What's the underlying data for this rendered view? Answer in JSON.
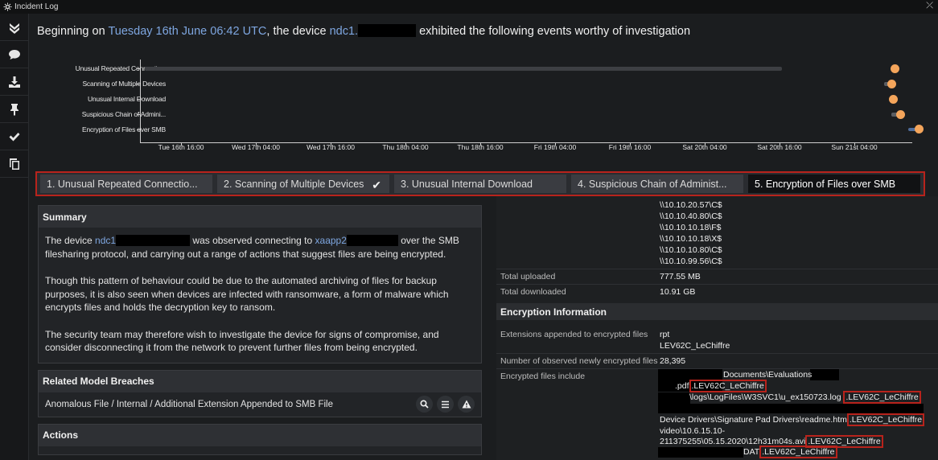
{
  "window": {
    "title": "Incident Log",
    "close": "⤫"
  },
  "sidebar": {
    "items": [
      "collapse",
      "comment",
      "download",
      "pin",
      "confirm",
      "copy"
    ]
  },
  "headline": {
    "prefix": "Beginning on ",
    "date": "Tuesday 16th June 06:42 UTC",
    "mid": ", the device ",
    "device": "ndc1.",
    "suffix": "exhibited the following events worthy of investigation"
  },
  "timeline": {
    "rows": [
      "Unusual Repeated Connectio...",
      "Scanning of Multiple Devices",
      "Unusual Internal Download",
      "Suspicious Chain of Admini...",
      "Encryption of Files over SMB"
    ],
    "dates": [
      "Tue 16th 16:00",
      "Wed 17th 04:00",
      "Wed 17th 16:00",
      "Thu 18th 04:00",
      "Thu 18th 16:00",
      "Fri 19th 04:00",
      "Fri 19th 16:00",
      "Sat 20th 04:00",
      "Sat 20th 16:00",
      "Sun 21st 04:00"
    ]
  },
  "tabs": [
    {
      "label": "1. Unusual Repeated Connectio...",
      "checked": false,
      "active": false
    },
    {
      "label": "2. Scanning of Multiple Devices",
      "checked": true,
      "active": false
    },
    {
      "label": "3. Unusual Internal Download",
      "checked": false,
      "active": false
    },
    {
      "label": "4. Suspicious Chain of Administ...",
      "checked": false,
      "active": false
    },
    {
      "label": "5. Encryption of Files over SMB",
      "checked": false,
      "active": true
    }
  ],
  "check_glyph": "✔",
  "summary": {
    "title": "Summary",
    "p1_a": "The device ",
    "p1_device": "ndc1",
    "p1_b": " was observed connecting to ",
    "p1_target": "xaapp2",
    "p1_c": " over the SMB filesharing protocol, and carrying out a range of actions that suggest files are being encrypted.",
    "p2": "Though this pattern of behaviour could be due to the automated archiving of files for backup purposes, it is also seen when devices are infected with ransomware, a form of malware which encrypts files and holds the decryption key to ransom.",
    "p3": "The security team may therefore wish to investigate the device for signs of compromise, and consider disconnecting it from the network to prevent further files from being encrypted."
  },
  "breaches": {
    "title": "Related Model Breaches",
    "item": "Anomalous File / Internal / Additional Extension Appended to SMB File",
    "icons": [
      "search-icon",
      "menu-icon",
      "warning-icon"
    ]
  },
  "actions": {
    "title": "Actions"
  },
  "details": {
    "shares": [
      "\\\\10.10.20.57\\C$",
      "\\\\10.10.40.80\\C$",
      "\\\\10.10.10.18\\F$",
      "\\\\10.10.10.18\\X$",
      "\\\\10.10.10.80\\C$",
      "\\\\10.10.99.56\\C$"
    ],
    "total_uploaded_label": "Total uploaded",
    "total_uploaded": "777.55 MB",
    "total_downloaded_label": "Total downloaded",
    "total_downloaded": "10.91 GB",
    "enc_title": "Encryption Information",
    "ext_label": "Extensions appended to encrypted files",
    "ext_1": "rpt",
    "ext_2": "LEV62C_LeChiffre",
    "count_label": "Number of observed newly encrypted files",
    "count": "28,395",
    "files_label": "Encrypted files include",
    "f1": "Documents\\Evaluations",
    "f2": ".pdf",
    "f2_ext": ".LEV62C_LeChiffre",
    "f3": "\\logs\\LogFiles\\W3SVC1\\u_ex150723.log",
    "f3_ext": ".LEV62C_LeChiffre",
    "f4": "Device Drivers\\Signature Pad Drivers\\readme.htm",
    "f4_ext": ".LEV62C_LeChiffre",
    "f5": "video\\10.6.15.10-",
    "f6": "211375255\\05.15.2020\\12h31m04s.avi",
    "f6_ext": ".LEV62C_LeChiffre",
    "f7": "DAT",
    "f7_ext": ".LEV62C_LeChiffre"
  }
}
